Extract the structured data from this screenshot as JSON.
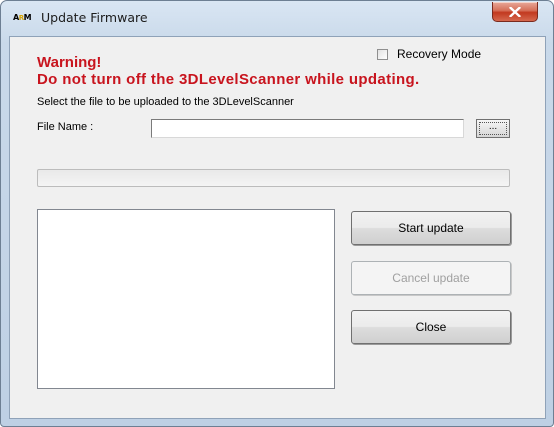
{
  "window": {
    "title": "Update Firmware",
    "logo_left": "A",
    "logo_mid": "R",
    "logo_right": "M"
  },
  "dialog": {
    "warning_line1": "Warning!",
    "warning_line2": "Do not turn off the 3DLevelScanner while updating.",
    "instruction": "Select the file to be uploaded to the 3DLevelScanner",
    "recovery_mode": {
      "label": "Recovery Mode",
      "checked": false
    },
    "file_name": {
      "label": "File Name :",
      "value": "",
      "browse_label": "..."
    },
    "progress": {
      "value_percent": 0
    },
    "log_text": "",
    "buttons": {
      "start": "Start update",
      "cancel": "Cancel update",
      "close": "Close"
    }
  },
  "colors": {
    "warning": "#c8141e",
    "close_button": "#c2391f",
    "client_background": "#f0f0f0"
  },
  "icons": {
    "close": "close-icon",
    "logo": "app-logo-icon"
  }
}
